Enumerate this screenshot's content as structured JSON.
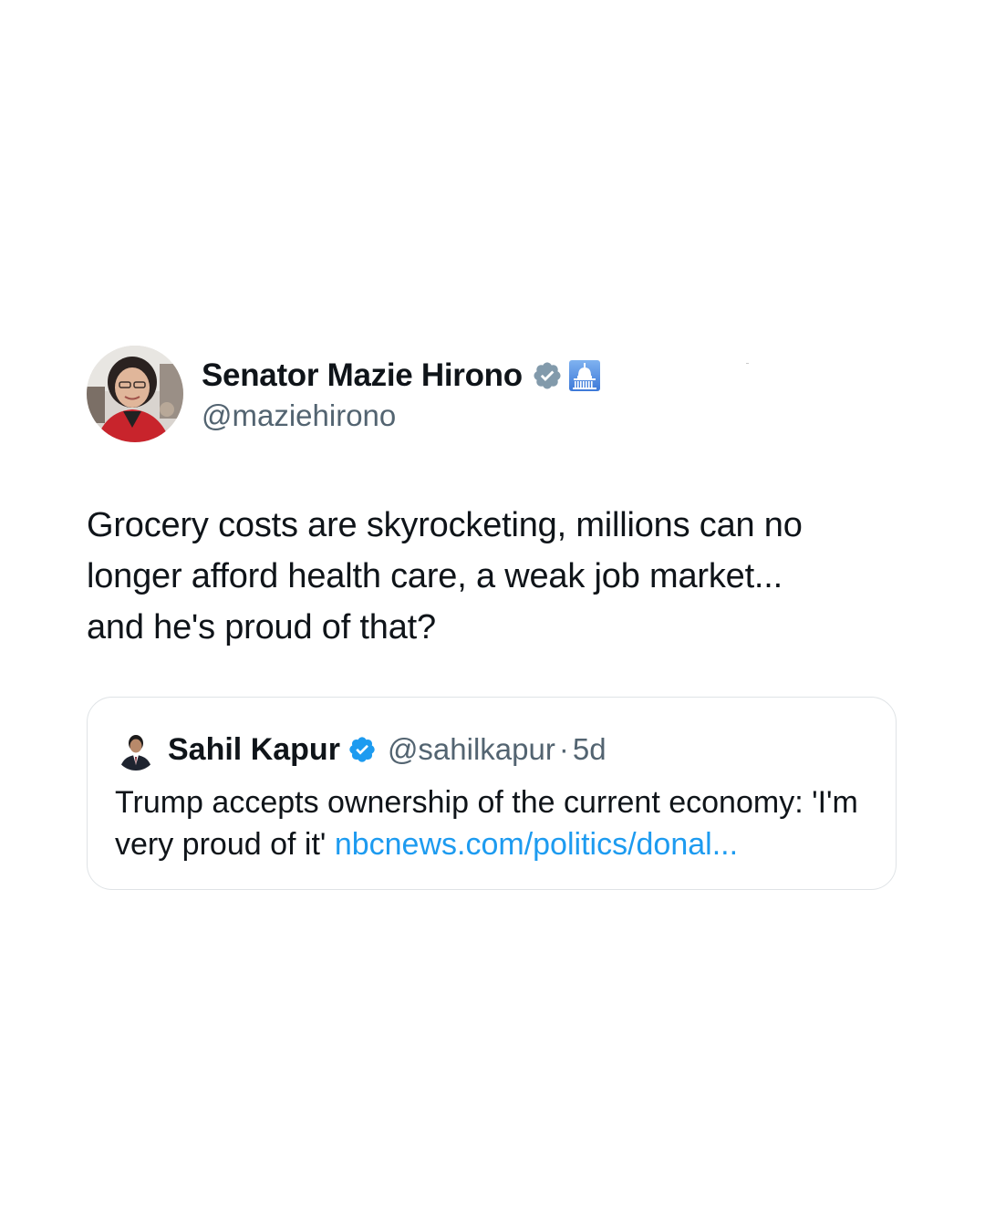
{
  "tweet": {
    "display_name": "Senator Mazie Hirono",
    "handle": "@maziehirono",
    "badges": [
      "verified-gray-icon",
      "capitol-icon"
    ],
    "text": "Grocery costs are skyrocketing, millions can no\nlonger afford health care, a weak job market...\nand he's proud of that?"
  },
  "quoted_tweet": {
    "display_name": "Sahil Kapur",
    "handle": "@sahilkapur",
    "separator": "·",
    "time": "5d",
    "text": "Trump accepts ownership of the current economy: 'I'm very proud of it' ",
    "link": "nbcnews.com/politics/donal..."
  },
  "colors": {
    "text": "#0f1419",
    "secondary": "#536471",
    "link": "#1d9bf0",
    "verified_blue": "#1d9bf0",
    "verified_gray": "#829aab",
    "card_border": "#dfe3e6"
  }
}
